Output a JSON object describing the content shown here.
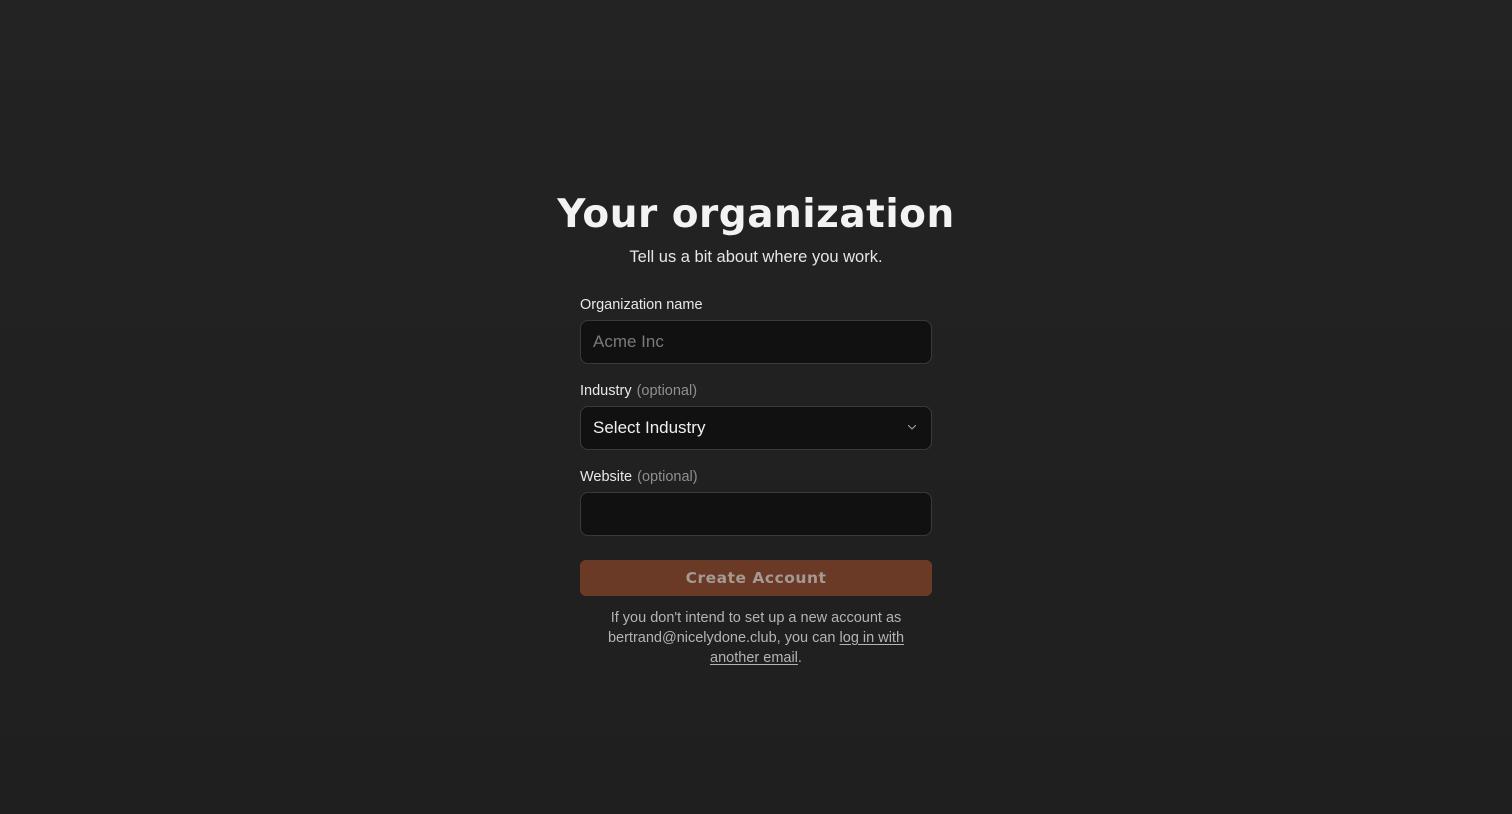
{
  "header": {
    "title": "Your organization",
    "subtitle": "Tell us a bit about where you work."
  },
  "fields": {
    "organization": {
      "label": "Organization name",
      "placeholder": "Acme Inc",
      "value": ""
    },
    "industry": {
      "label": "Industry",
      "optional": "(optional)",
      "selected": "Select Industry",
      "icon": "chevron-down-icon"
    },
    "website": {
      "label": "Website",
      "optional": "(optional)",
      "value": ""
    }
  },
  "actions": {
    "create_label": "Create Account"
  },
  "footnote": {
    "prefix": "If you don't intend to set up a new account as bertrand@nicelydone.club, you can ",
    "link": "log in with another email",
    "suffix": "."
  },
  "colors": {
    "background": "#212121",
    "input_bg": "#111111",
    "button_bg": "#6b3a26",
    "muted_text": "#8f8f8f"
  }
}
